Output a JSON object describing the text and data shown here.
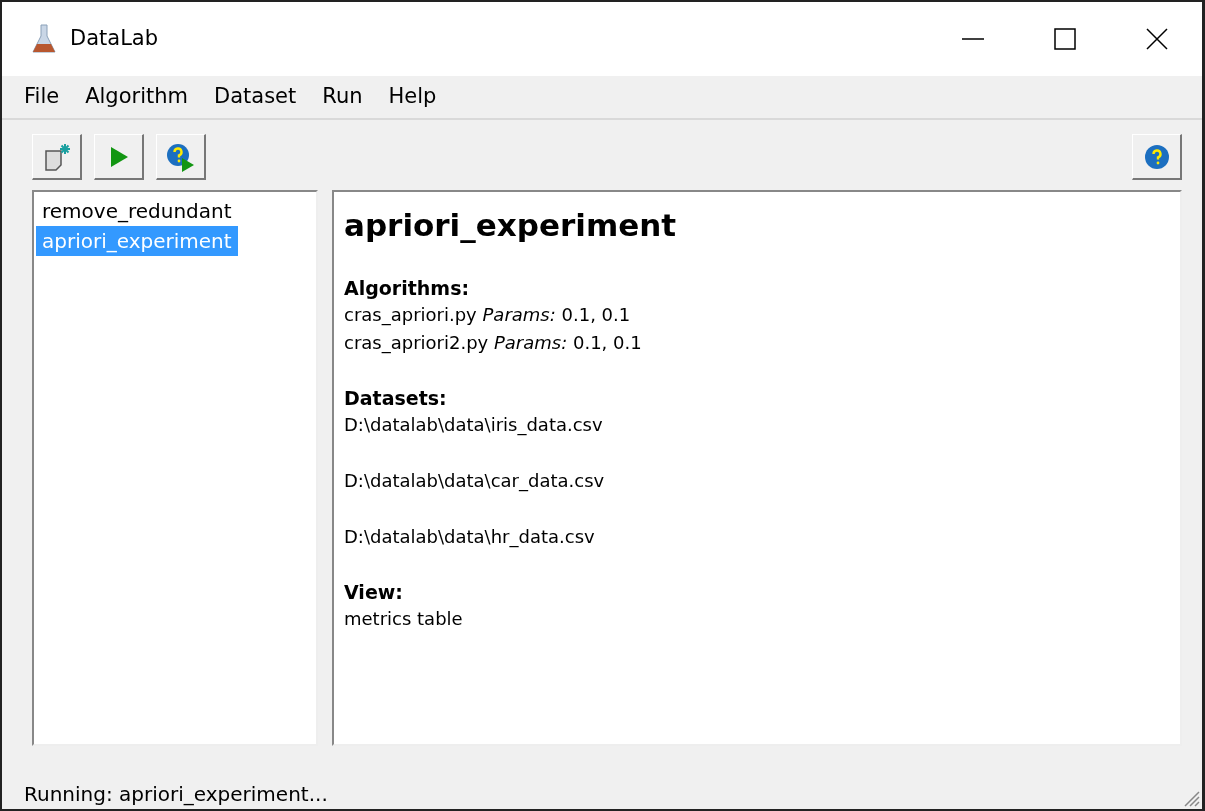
{
  "window": {
    "title": "DataLab"
  },
  "menu": [
    "File",
    "Algorithm",
    "Dataset",
    "Run",
    "Help"
  ],
  "experiments": [
    {
      "label": "remove_redundant",
      "selected": false
    },
    {
      "label": "apriori_experiment",
      "selected": true
    }
  ],
  "detail": {
    "title": "apriori_experiment",
    "sections": [
      {
        "heading": "Algorithms:",
        "kind": "compact",
        "lines": [
          "cras_apriori.py *Params:* 0.1, 0.1",
          "cras_apriori2.py *Params:* 0.1, 0.1"
        ]
      },
      {
        "heading": "Datasets:",
        "kind": "spaced",
        "lines": [
          "D:\\datalab\\data\\iris_data.csv",
          "D:\\datalab\\data\\car_data.csv",
          "D:\\datalab\\data\\hr_data.csv"
        ]
      },
      {
        "heading": "View:",
        "kind": "compact",
        "lines": [
          "metrics table"
        ]
      }
    ]
  },
  "status_bar": "Running: apriori_experiment..."
}
